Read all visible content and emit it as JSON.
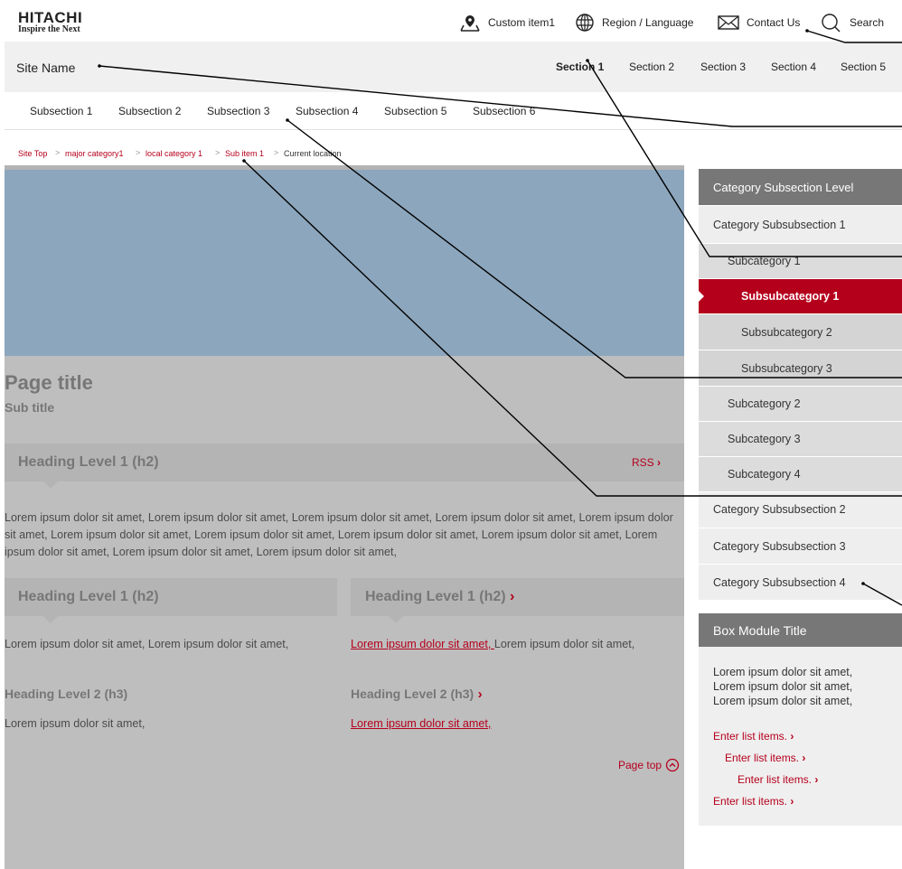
{
  "header": {
    "logo_main": "HITACHI",
    "logo_sub": "Inspire the Next",
    "utility": {
      "custom_item": "Custom item1",
      "region": "Region / Language",
      "contact": "Contact Us",
      "search": "Search"
    }
  },
  "site_bar": {
    "site_name": "Site Name",
    "sections": [
      "Section 1",
      "Section 2",
      "Section 3",
      "Section 4",
      "Section 5"
    ],
    "active_section": "Section 1"
  },
  "subsections": [
    "Subsection 1",
    "Subsection 2",
    "Subsection 3",
    "Subsection 4",
    "Subsection 5",
    "Subsection 6"
  ],
  "breadcrumb": {
    "items": [
      "Site Top",
      "major category1",
      "local category 1",
      "Sub item 1"
    ],
    "current": "Current location",
    "separator": ">"
  },
  "main": {
    "page_title": "Page title",
    "sub_title": "Sub title",
    "heading1": "Heading Level 1 (h2)",
    "rss": "RSS",
    "paragraph": "Lorem ipsum dolor sit amet, Lorem ipsum dolor sit amet, Lorem ipsum dolor sit amet, Lorem ipsum dolor sit amet, Lorem ipsum dolor sit amet, Lorem ipsum dolor sit amet, Lorem ipsum dolor sit amet, Lorem ipsum dolor sit amet, Lorem ipsum dolor sit amet, Lorem ipsum dolor sit amet, Lorem ipsum dolor sit amet, Lorem ipsum dolor sit amet,",
    "left_col": {
      "heading": "Heading Level 1 (h2)",
      "text": "Lorem ipsum dolor sit amet, Lorem ipsum dolor sit amet,",
      "h3": "Heading Level 2 (h3)",
      "text2": "Lorem ipsum dolor sit amet,"
    },
    "right_col": {
      "heading": "Heading Level 1 (h2)",
      "link_text": "Lorem ipsum dolor sit amet, ",
      "text": "Lorem ipsum dolor sit amet,",
      "h3": "Heading Level 2 (h3)",
      "link2": "Lorem ipsum dolor sit amet,"
    },
    "page_top": "Page top"
  },
  "sidebar": {
    "category_title": "Category Subsection Level",
    "nav": [
      {
        "label": "Category Subsubsection 1",
        "level": 1
      },
      {
        "label": "Subcategory 1",
        "level": 2
      },
      {
        "label": "Subsubcategory 1",
        "level": 3,
        "active": true
      },
      {
        "label": "Subsubcategory 2",
        "level": 3
      },
      {
        "label": "Subsubcategory 3",
        "level": 3
      },
      {
        "label": "Subcategory 2",
        "level": 2
      },
      {
        "label": "Subcategory 3",
        "level": 2
      },
      {
        "label": "Subcategory 4",
        "level": 2
      },
      {
        "label": "Category Subsubsection 2",
        "level": 1
      },
      {
        "label": "Category Subsubsection 3",
        "level": 1
      },
      {
        "label": "Category Subsubsection 4",
        "level": 1
      }
    ],
    "box": {
      "title": "Box Module Title",
      "lines": [
        "Lorem ipsum dolor sit amet,",
        "Lorem ipsum dolor sit amet,",
        "Lorem ipsum dolor sit amet,"
      ],
      "list": [
        "Enter list items.",
        "Enter list items.",
        "Enter list items.",
        "Enter list items."
      ]
    }
  },
  "colors": {
    "accent_red": "#b5001c",
    "hero_blue": "#8ca6bd",
    "main_gray": "#bebebe"
  }
}
